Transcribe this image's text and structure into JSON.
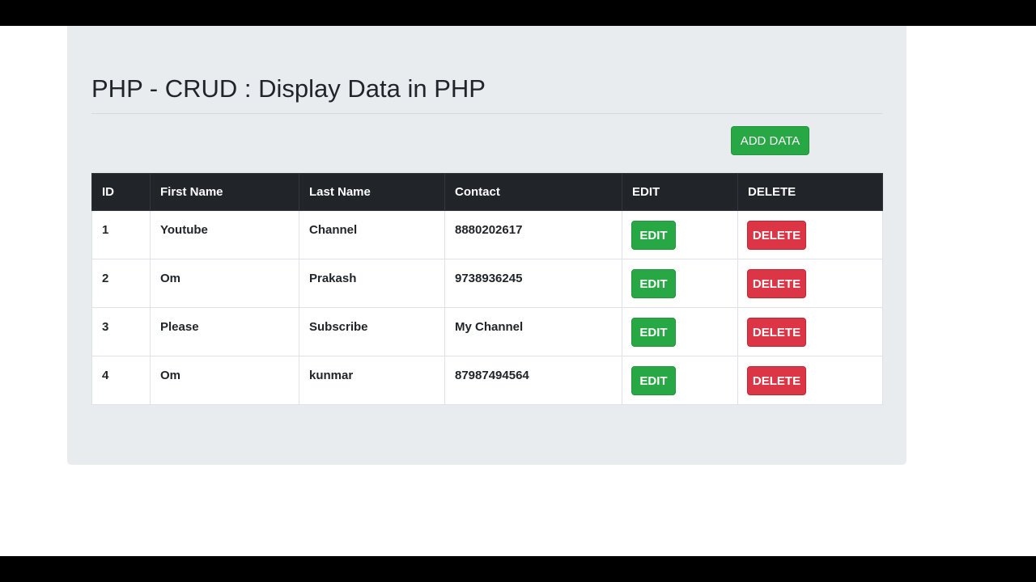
{
  "page": {
    "title": "PHP - CRUD : Display Data in PHP",
    "add_button_label": "ADD DATA"
  },
  "table": {
    "headers": [
      "ID",
      "First Name",
      "Last Name",
      "Contact",
      "EDIT",
      "DELETE"
    ],
    "rows": [
      {
        "id": "1",
        "first_name": "Youtube",
        "last_name": "Channel",
        "contact": "8880202617",
        "edit_label": "EDIT",
        "delete_label": "DELETE"
      },
      {
        "id": "2",
        "first_name": "Om",
        "last_name": "Prakash",
        "contact": "9738936245",
        "edit_label": "EDIT",
        "delete_label": "DELETE"
      },
      {
        "id": "3",
        "first_name": "Please",
        "last_name": "Subscribe",
        "contact": "My Channel",
        "edit_label": "EDIT",
        "delete_label": "DELETE"
      },
      {
        "id": "4",
        "first_name": "Om",
        "last_name": "kunmar",
        "contact": "87987494564",
        "edit_label": "EDIT",
        "delete_label": "DELETE"
      }
    ]
  },
  "colors": {
    "success": "#28a745",
    "danger": "#dc3545",
    "table_header_bg": "#212529",
    "panel_bg": "#e9ecef"
  }
}
